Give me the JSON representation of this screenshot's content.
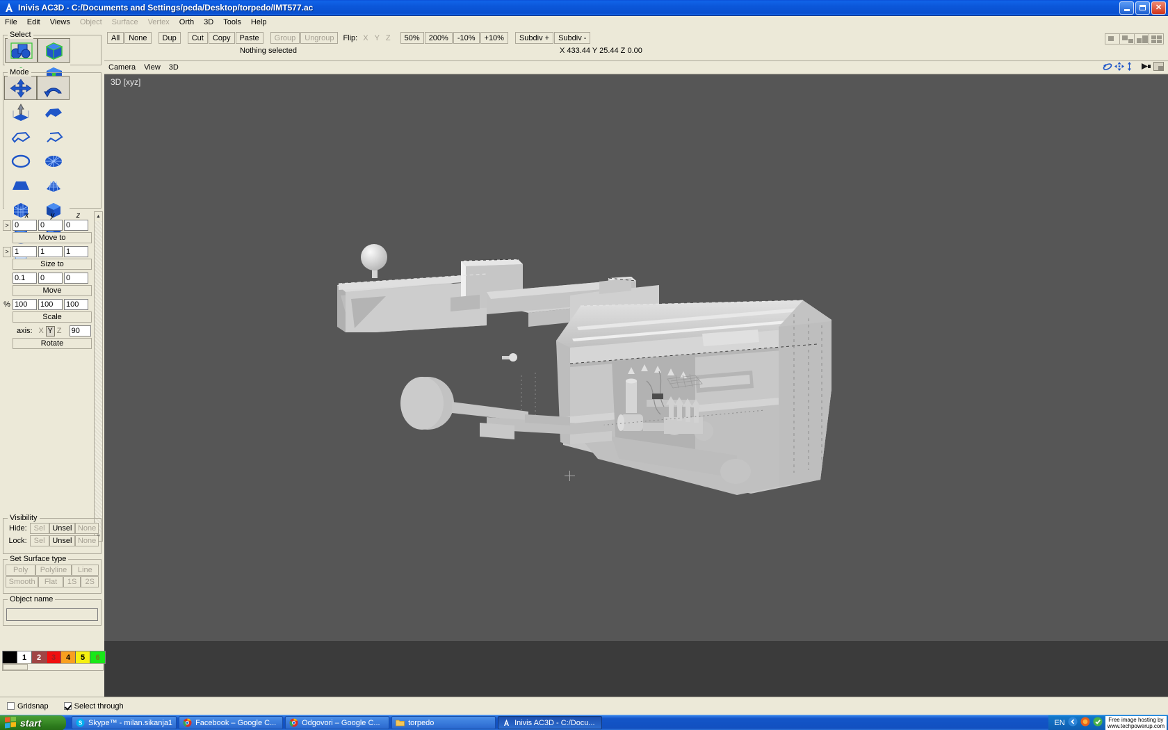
{
  "window": {
    "title": "Inivis AC3D - C:/Documents and Settings/peda/Desktop/torpedo/IMT577.ac",
    "app_icon": "ac3d-logo-icon",
    "minimize_label": "_",
    "maximize_label": "□",
    "close_label": "✕"
  },
  "menubar": {
    "items": [
      {
        "label": "File",
        "disabled": false
      },
      {
        "label": "Edit",
        "disabled": false
      },
      {
        "label": "Views",
        "disabled": false
      },
      {
        "label": "Object",
        "disabled": true
      },
      {
        "label": "Surface",
        "disabled": true
      },
      {
        "label": "Vertex",
        "disabled": true
      },
      {
        "label": "Orth",
        "disabled": false
      },
      {
        "label": "3D",
        "disabled": false
      },
      {
        "label": "Tools",
        "disabled": false
      },
      {
        "label": "Help",
        "disabled": false
      }
    ]
  },
  "select_panel": {
    "title": "Select",
    "buttons": [
      {
        "name": "select-group-icon",
        "selected": true
      },
      {
        "name": "select-object-icon",
        "selected": true
      },
      {
        "name": "select-surface-icon",
        "selected": false
      },
      {
        "name": "select-vertex-icon",
        "selected": false
      }
    ]
  },
  "mode_panel": {
    "title": "Mode",
    "buttons": [
      {
        "name": "move-mode-icon",
        "selected": true
      },
      {
        "name": "rotate-mode-icon",
        "selected": true
      },
      {
        "name": "extrude-mode-icon",
        "selected": false
      },
      {
        "name": "poly-mode-icon",
        "selected": false
      },
      {
        "name": "polyline-mode-icon",
        "selected": false
      },
      {
        "name": "line-mode-icon",
        "selected": false
      },
      {
        "name": "disc-primitive-icon",
        "selected": false
      },
      {
        "name": "cylinder-disc-primitive-icon",
        "selected": false
      },
      {
        "name": "cone-primitive-icon",
        "selected": false
      },
      {
        "name": "plane-grid-primitive-icon",
        "selected": false
      },
      {
        "name": "box-grid-primitive-icon",
        "selected": false
      },
      {
        "name": "box-primitive-icon",
        "selected": false
      },
      {
        "name": "cylinder-primitive-icon",
        "selected": false
      },
      {
        "name": "sphere-primitive-icon",
        "selected": false
      },
      {
        "name": "light-primitive-icon",
        "selected": false
      }
    ]
  },
  "transform": {
    "axis_headers": [
      "x",
      "y",
      "z"
    ],
    "move_to": {
      "values": [
        "0",
        "0",
        "0"
      ],
      "button": "Move to",
      "expander": ">"
    },
    "size_to": {
      "values": [
        "1",
        "1",
        "1"
      ],
      "button": "Size to",
      "expander": ">"
    },
    "move": {
      "values": [
        "0.1",
        "0",
        "0"
      ],
      "button": "Move"
    },
    "scale": {
      "values": [
        "100",
        "100",
        "100"
      ],
      "button": "Scale",
      "unit": "%"
    },
    "rotate": {
      "axis_label": "axis:",
      "axes": [
        "X",
        "Y",
        "Z"
      ],
      "active_axis": "Y",
      "angle": "90",
      "button": "Rotate"
    }
  },
  "visibility": {
    "title": "Visibility",
    "rows": [
      {
        "label": "Hide:",
        "buttons": [
          {
            "label": "Sel",
            "disabled": true
          },
          {
            "label": "Unsel",
            "disabled": false
          },
          {
            "label": "None",
            "disabled": true
          }
        ]
      },
      {
        "label": "Lock:",
        "buttons": [
          {
            "label": "Sel",
            "disabled": true
          },
          {
            "label": "Unsel",
            "disabled": false
          },
          {
            "label": "None",
            "disabled": true
          }
        ]
      }
    ]
  },
  "surface_type": {
    "title": "Set Surface type",
    "row1": [
      {
        "label": "Poly",
        "disabled": true
      },
      {
        "label": "Polyline",
        "disabled": true
      },
      {
        "label": "Line",
        "disabled": true
      }
    ],
    "row2": [
      {
        "label": "Smooth",
        "disabled": true
      },
      {
        "label": "Flat",
        "disabled": true
      },
      {
        "label": "1S",
        "disabled": true
      },
      {
        "label": "2S",
        "disabled": true
      }
    ]
  },
  "object_name": {
    "title": "Object name",
    "value": "",
    "placeholder": ""
  },
  "palette": {
    "swatches": [
      {
        "label": "",
        "color": "#000000",
        "text_color": "#ffffff"
      },
      {
        "label": "1",
        "color": "#ffffff",
        "text_color": "#000000"
      },
      {
        "label": "2",
        "color": "#a04545",
        "text_color": "#ffffff"
      },
      {
        "label": "3",
        "color": "#f01010",
        "text_color": "#a02020"
      },
      {
        "label": "4",
        "color": "#f8a020",
        "text_color": "#000000"
      },
      {
        "label": "5",
        "color": "#f5f010",
        "text_color": "#000000"
      },
      {
        "label": "6",
        "color": "#18e818",
        "text_color": "#7a7a20"
      }
    ]
  },
  "toolbar": {
    "groups": [
      [
        {
          "label": "All",
          "disabled": false
        },
        {
          "label": "None",
          "disabled": false
        }
      ],
      [
        {
          "label": "Dup",
          "disabled": false
        }
      ],
      [
        {
          "label": "Cut",
          "disabled": false
        },
        {
          "label": "Copy",
          "disabled": false
        },
        {
          "label": "Paste",
          "disabled": false
        }
      ],
      [
        {
          "label": "Group",
          "disabled": true
        },
        {
          "label": "Ungroup",
          "disabled": true
        }
      ],
      [
        {
          "label": "50%",
          "disabled": false
        },
        {
          "label": "200%",
          "disabled": false
        },
        {
          "label": "-10%",
          "disabled": false
        },
        {
          "label": "+10%",
          "disabled": false
        }
      ],
      [
        {
          "label": "Subdiv +",
          "disabled": false
        },
        {
          "label": "Subdiv -",
          "disabled": false
        }
      ]
    ],
    "flip_label": "Flip:",
    "flip_axes": [
      {
        "label": "X",
        "disabled": true
      },
      {
        "label": "Y",
        "disabled": true
      },
      {
        "label": "Z",
        "disabled": true
      }
    ],
    "status": "Nothing selected",
    "coords": "X 433.44 Y 25.44 Z 0.00",
    "layout_buttons": [
      "single-view-layout-icon",
      "two-view-layout-icon",
      "three-view-layout-icon",
      "four-view-layout-icon"
    ]
  },
  "viewport": {
    "menu": [
      "Camera",
      "View",
      "3D"
    ],
    "label": "3D [xyz]",
    "background_color": "#565656",
    "model_color": "#c8c8c8",
    "icons": [
      "orbit-icon",
      "pan-icon",
      "zoom-icon",
      "render-icon",
      "maximize-view-icon"
    ]
  },
  "bottom_options": {
    "gridsnap": {
      "label": "Gridsnap",
      "checked": false
    },
    "select_through": {
      "label": "Select through",
      "checked": true
    }
  },
  "taskbar": {
    "start_label": "start",
    "tasks": [
      {
        "label": "Skype™ - milan.sikanja1",
        "icon": "skype-icon",
        "active": false
      },
      {
        "label": "Facebook – Google C...",
        "icon": "chrome-icon",
        "active": false
      },
      {
        "label": "Odgovori – Google C...",
        "icon": "chrome-icon",
        "active": false
      },
      {
        "label": "torpedo",
        "icon": "folder-icon",
        "active": false
      },
      {
        "label": "Inivis AC3D - C:/Docu...",
        "icon": "ac3d-logo-icon",
        "active": true
      }
    ],
    "tray": {
      "language": "EN",
      "icons": [
        "tray-chevron-icon",
        "firefox-tray-icon",
        "shield-tray-icon"
      ]
    },
    "watermark_line1": "Free image hosting by",
    "watermark_line2": "www.techpowerup.com"
  }
}
